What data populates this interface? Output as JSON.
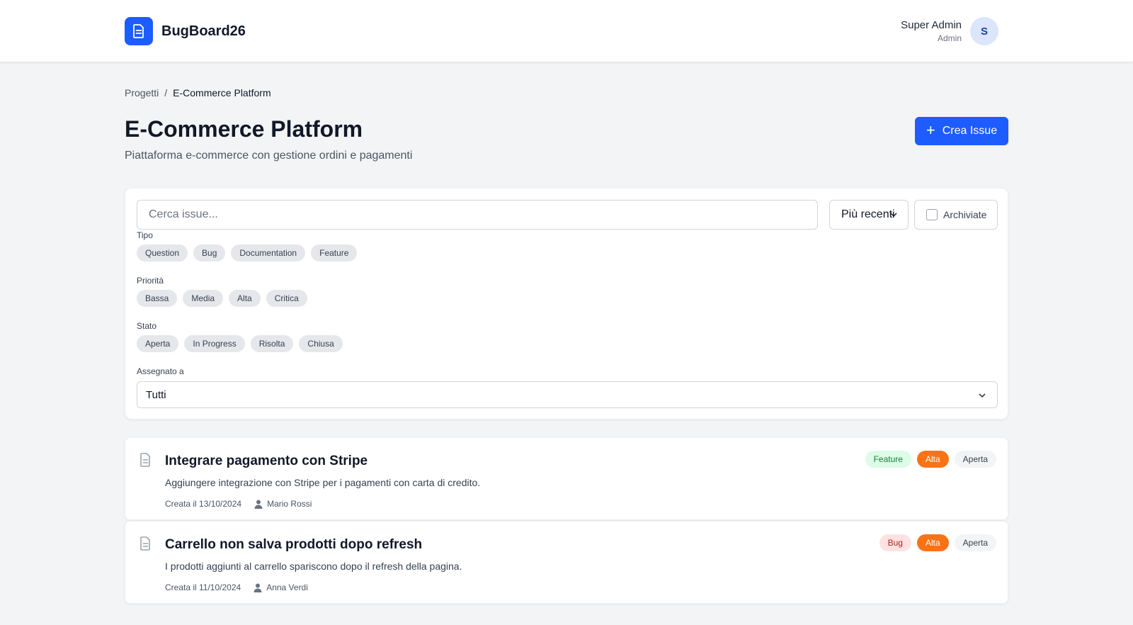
{
  "header": {
    "app_name": "BugBoard26",
    "user_name": "Super Admin",
    "user_role": "Admin",
    "avatar_initial": "S",
    "logo_icon": "document-icon"
  },
  "breadcrumb": {
    "root": "Progetti",
    "separator": "/",
    "current": "E-Commerce Platform"
  },
  "page": {
    "title": "E-Commerce Platform",
    "subtitle": "Piattaforma e-commerce con gestione ordini e pagamenti",
    "create_label": "Crea Issue",
    "create_icon": "+"
  },
  "filters": {
    "search_placeholder": "Cerca issue...",
    "sort_value": "Più recenti",
    "archive_label": "Archiviate",
    "tipo_label": "Tipo",
    "tipo_options": [
      "Question",
      "Bug",
      "Documentation",
      "Feature"
    ],
    "priorita_label": "Priorità",
    "priorita_options": [
      "Bassa",
      "Media",
      "Alta",
      "Critica"
    ],
    "stato_label": "Stato",
    "stato_options": [
      "Aperta",
      "In Progress",
      "Risolta",
      "Chiusa"
    ],
    "assegnato_label": "Assegnato a",
    "assegnato_value": "Tutti"
  },
  "issues": [
    {
      "title": "Integrare pagamento con Stripe",
      "description": "Aggiungere integrazione con Stripe per i pagamenti con carta di credito.",
      "created": "Creata il 13/10/2024",
      "author": "Mario Rossi",
      "type": "Feature",
      "priority": "Alta",
      "status": "Aperta"
    },
    {
      "title": "Carrello non salva prodotti dopo refresh",
      "description": "I prodotti aggiunti al carrello spariscono dopo il refresh della pagina.",
      "created": "Creata il 11/10/2024",
      "author": "Anna Verdi",
      "type": "Bug",
      "priority": "Alta",
      "status": "Aperta"
    }
  ],
  "colors": {
    "primary": "#1d5cff",
    "feature_bg": "#dcfce7",
    "feature_text": "#15803d",
    "bug_bg": "#fee2e2",
    "bug_text": "#b91c1c",
    "priority_high_bg": "#f97316",
    "status_bg": "#f3f4f6"
  }
}
